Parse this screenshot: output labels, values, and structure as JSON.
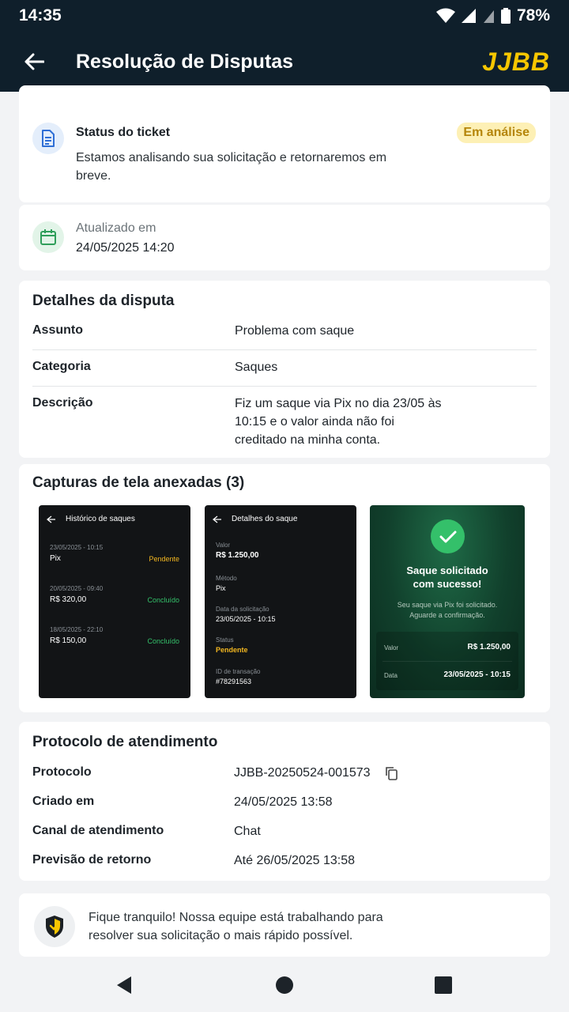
{
  "status_bar": {
    "time": "14:35",
    "battery": "78%"
  },
  "app_bar": {
    "title": "Resolução de Disputas",
    "brand": "JJBB"
  },
  "ticket_status": {
    "title": "Status do ticket",
    "description": "Estamos analisando sua solicitação e retornaremos em breve.",
    "badge": "Em análise"
  },
  "updated": {
    "label": "Atualizado em",
    "value": "24/05/2025 14:20"
  },
  "details": {
    "title": "Detalhes da disputa",
    "rows": [
      {
        "label": "Assunto",
        "value": "Problema com saque"
      },
      {
        "label": "Categoria",
        "value": "Saques"
      },
      {
        "label": "Descrição",
        "value": "Fiz um saque via Pix no dia 23/05 às 10:15 e o valor ainda não foi creditado na minha conta."
      }
    ]
  },
  "attachments": {
    "title": "Capturas de tela anexadas (3)",
    "shot1": {
      "header": "Histórico de saques",
      "items": [
        {
          "date": "23/05/2025 - 10:15",
          "name": "Pix",
          "status": "Pendente"
        },
        {
          "date": "20/05/2025 - 09:40",
          "name": "R$ 320,00",
          "status": "Concluído"
        },
        {
          "date": "18/05/2025 - 22:10",
          "name": "R$ 150,00",
          "status": "Concluído"
        }
      ]
    },
    "shot2": {
      "header": "Detalhes do saque",
      "value_label": "Valor",
      "value": "R$ 1.250,00",
      "method_label": "Método",
      "method": "Pix",
      "date_label": "Data da solicitação",
      "date": "23/05/2025 - 10:15",
      "status_label": "Status",
      "status": "Pendente",
      "tx_label": "ID de transação",
      "tx": "#78291563"
    },
    "shot3": {
      "title_line1": "Saque solicitado",
      "title_line2": "com sucesso!",
      "sub_line1": "Seu saque via Pix foi solicitado.",
      "sub_line2": "Aguarde a confirmação.",
      "value_label": "Valor",
      "value": "R$ 1.250,00",
      "date_label": "Data",
      "date": "23/05/2025 - 10:15"
    }
  },
  "protocol": {
    "title": "Protocolo de atendimento",
    "rows": [
      {
        "label": "Protocolo",
        "value": "JJBB-20250524-001573"
      },
      {
        "label": "Criado em",
        "value": "24/05/2025 13:58"
      },
      {
        "label": "Canal de atendimento",
        "value": "Chat"
      },
      {
        "label": "Previsão de retorno",
        "value": "Até 26/05/2025 13:58"
      }
    ]
  },
  "tip": {
    "text": "Fique tranquilo! Nossa equipe está trabalhando para resolver sua solicitação o mais rápido possível."
  },
  "colors": {
    "accent": "#f7c600",
    "header_bg": "#0f1f2b",
    "badge_bg": "#fdf0b5",
    "pending": "#f2b720",
    "success": "#34c06a"
  }
}
